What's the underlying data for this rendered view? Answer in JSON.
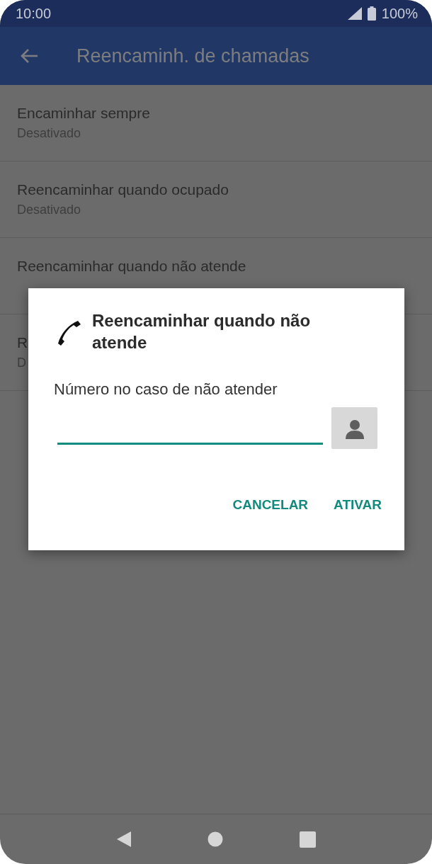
{
  "status_bar": {
    "time": "10:00",
    "battery": "100%"
  },
  "app_bar": {
    "title": "Reencaminh. de chamadas"
  },
  "settings": [
    {
      "title": "Encaminhar sempre",
      "subtitle": "Desativado"
    },
    {
      "title": "Reencaminhar quando ocupado",
      "subtitle": "Desativado"
    },
    {
      "title": "Reencaminhar quando não atende"
    },
    {
      "title": "R",
      "subtitle": "D"
    }
  ],
  "dialog": {
    "title": "Reencaminhar quando não atende",
    "field_label": "Número no caso de não atender",
    "buttons": [
      "CANCELAR",
      "ATIVAR"
    ]
  }
}
